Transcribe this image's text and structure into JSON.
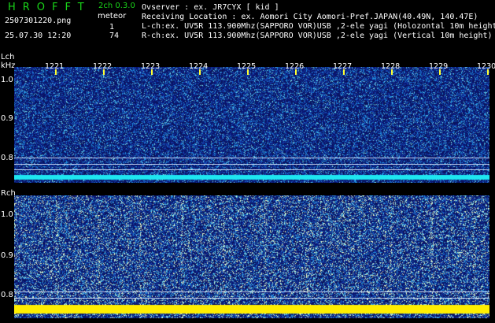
{
  "header": {
    "logo": "HROFFT",
    "filename": "2507301220.png",
    "datetime": "25.07.30 12:20",
    "mode": "2ch 0.3.0",
    "meteor_label": "meteor",
    "lch_count": "1",
    "rch_count": "74",
    "observer": "Ovserver            : ex. JR7CYX [ kid ]",
    "location": "Receiving Location : ex. Aomori City Aomori-Pref.JAPAN(40.49N, 140.47E)",
    "lch_info": "L-ch:ex. UV5R 113.900Mhz(SAPPORO VOR)USB ,2-ele yagi (Holozontal 10m height)",
    "rch_info": "R-ch:ex. UV5R 113.900Mhz(SAPPORO VOR)USB ,2-ele yagi (Vertical 10m height)"
  },
  "lch": {
    "label": "Lch",
    "unit": "kHz",
    "yticks": [
      "1.0",
      "0.9",
      "0.8"
    ]
  },
  "rch": {
    "label": "Rch",
    "yticks": [
      "1.0",
      "0.9",
      "0.8"
    ]
  },
  "time_axis": [
    "1221",
    "1222",
    "1223",
    "1224",
    "1225",
    "1226",
    "1227",
    "1228",
    "1229",
    "1230"
  ],
  "colors": {
    "text_green": "#19d419",
    "tick_yellow": "#ffff33",
    "carrier_cyan": "#1ee6f0",
    "carrier_yellow": "#ffee00"
  }
}
